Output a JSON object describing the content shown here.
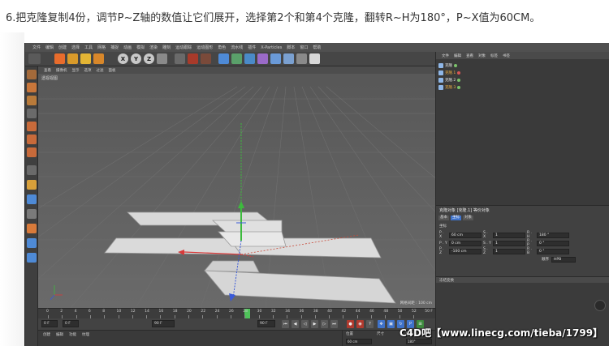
{
  "instruction": "6.把克隆复制4份，调节P~Z轴的数值让它们展开，选择第2个和第4个克隆，翻转R~H为180°，P~X值为60CM。",
  "app": {
    "menu": [
      "文件",
      "编辑",
      "创建",
      "选择",
      "工具",
      "网格",
      "捕捉",
      "动画",
      "模拟",
      "渲染",
      "雕刻",
      "运动跟踪",
      "运动图形",
      "角色",
      "流水线",
      "插件",
      "X-Particles",
      "脚本",
      "窗口",
      "帮助"
    ],
    "toolbar_axes": [
      "X",
      "Y",
      "Z"
    ],
    "viewport": {
      "menu": [
        "查看",
        "摄像机",
        "显示",
        "选项",
        "过滤",
        "面板"
      ],
      "label": "透视视图",
      "grid_info": "网格间距 : 100 cm"
    },
    "timeline": {
      "ticks": [
        "0",
        "2",
        "4",
        "6",
        "8",
        "10",
        "12",
        "14",
        "16",
        "18",
        "20",
        "22",
        "24",
        "26",
        "28",
        "30",
        "32",
        "34",
        "36",
        "38",
        "40",
        "42",
        "44",
        "46",
        "48",
        "50",
        "52"
      ],
      "current_frame": "F",
      "end_label": "50 F",
      "playhead_frame": "28"
    },
    "transport": {
      "start_field": "0 F",
      "current_field": "0 F",
      "end_field": "90 F",
      "end_field2": "90 F"
    },
    "material_bar": {
      "menu": [
        "创建",
        "编辑",
        "功能",
        "纹理"
      ]
    },
    "coordinates": {
      "header_pos": "位置",
      "header_size": "尺寸",
      "header_rot": "旋转",
      "x_value": "60 cm",
      "h_value": "180°"
    },
    "right_panel": {
      "tabs": [
        "文件",
        "编辑",
        "查看",
        "对象",
        "标签",
        "书签"
      ],
      "objects": [
        {
          "name": "克隆",
          "active": false
        },
        {
          "name": "克隆.1",
          "active": true
        },
        {
          "name": "克隆.2",
          "active": false
        },
        {
          "name": "克隆.3",
          "active": false
        }
      ],
      "attributes": {
        "title": "克隆对象 [克隆.1] 等价对象",
        "subtabs": [
          "基本",
          "坐标",
          "对象"
        ],
        "section": "坐标",
        "rows": [
          {
            "label": "P . X",
            "value": "60 cm",
            "label2": "S . X",
            "value2": "1",
            "label3": "R . H",
            "value3": "180 °"
          },
          {
            "label": "P . Y",
            "value": "0 cm",
            "label2": "S . Y",
            "value2": "1",
            "label3": "R . P",
            "value3": "0 °"
          },
          {
            "label": "P . Z",
            "value": "-100 cm",
            "label2": "S . Z",
            "value2": "1",
            "label3": "R . B",
            "value3": "0 °"
          }
        ],
        "order_label": "顺序",
        "order_value": "HPB",
        "footer": "冻结变换"
      }
    }
  },
  "watermark": "C4D吧【www.linecg.com/tieba/1799】"
}
